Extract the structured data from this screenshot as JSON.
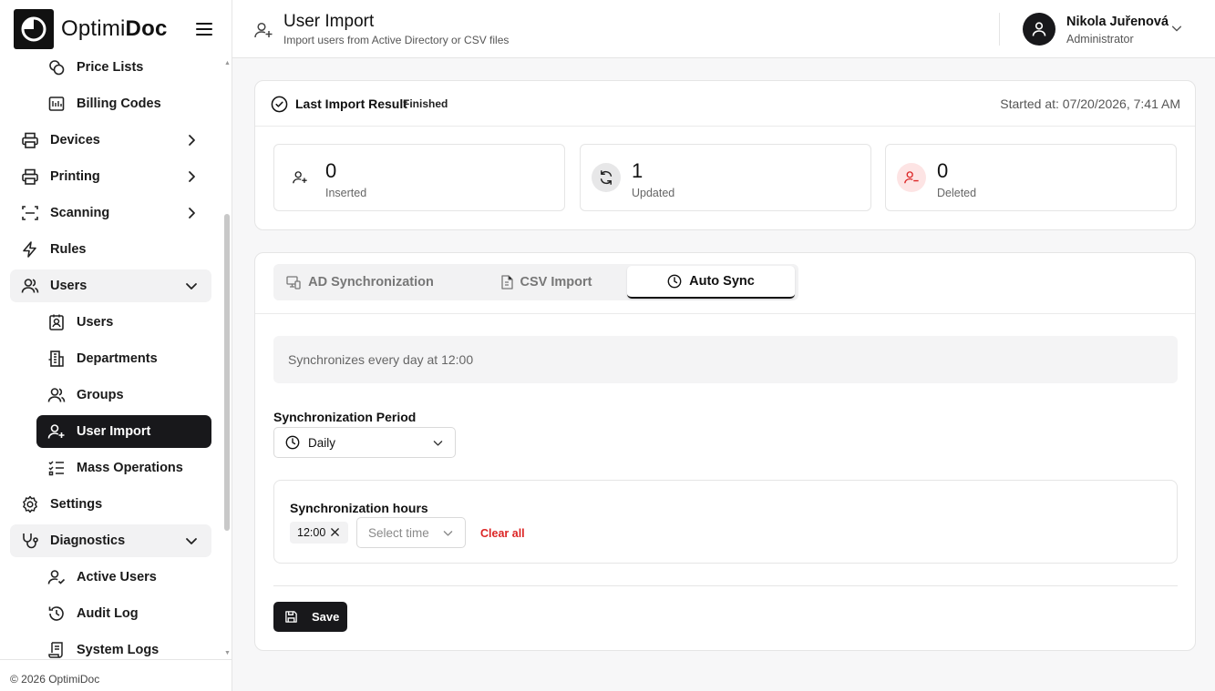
{
  "brand": {
    "name_light": "Optimi",
    "name_bold": "Doc"
  },
  "sidebar": {
    "items": [
      {
        "label": "Price Lists",
        "icon": "coins-icon",
        "level": 2
      },
      {
        "label": "Billing Codes",
        "icon": "billing-icon",
        "level": 2
      },
      {
        "label": "Devices",
        "icon": "printer-icon",
        "level": 1,
        "chevron": "right"
      },
      {
        "label": "Printing",
        "icon": "printer-icon",
        "level": 1,
        "chevron": "right"
      },
      {
        "label": "Scanning",
        "icon": "scan-icon",
        "level": 1,
        "chevron": "right"
      },
      {
        "label": "Rules",
        "icon": "lightning-icon",
        "level": 1
      },
      {
        "label": "Users",
        "icon": "users-icon",
        "level": 1,
        "chevron": "down",
        "open": true
      },
      {
        "label": "Users",
        "icon": "contact-icon",
        "level": 2
      },
      {
        "label": "Departments",
        "icon": "building-icon",
        "level": 2
      },
      {
        "label": "Groups",
        "icon": "users-icon",
        "level": 2
      },
      {
        "label": "User Import",
        "icon": "user-plus-icon",
        "level": 2,
        "active": true
      },
      {
        "label": "Mass Operations",
        "icon": "list-checks-icon",
        "level": 2
      },
      {
        "label": "Settings",
        "icon": "gear-icon",
        "level": 1
      },
      {
        "label": "Diagnostics",
        "icon": "stethoscope-icon",
        "level": 1,
        "chevron": "down",
        "open": true
      },
      {
        "label": "Active Users",
        "icon": "user-check-icon",
        "level": 2
      },
      {
        "label": "Audit Log",
        "icon": "history-icon",
        "level": 2
      },
      {
        "label": "System Logs",
        "icon": "scroll-icon",
        "level": 2
      }
    ],
    "footer": "© 2026 OptimiDoc"
  },
  "header": {
    "title": "User Import",
    "subtitle": "Import users from Active Directory or CSV files",
    "user_name": "Nikola Juřenová",
    "user_role": "Administrator"
  },
  "last_import": {
    "title": "Last Import Result",
    "status": "Finished",
    "started_at": "Started at: 07/20/2026, 7:41 AM",
    "stats": [
      {
        "value": "0",
        "label": "Inserted",
        "icon": "user-plus-icon"
      },
      {
        "value": "1",
        "label": "Updated",
        "icon": "refresh-icon"
      },
      {
        "value": "0",
        "label": "Deleted",
        "icon": "user-minus-icon"
      }
    ]
  },
  "tabs": [
    {
      "label": "AD Synchronization",
      "icon": "ad-sync-icon"
    },
    {
      "label": "CSV Import",
      "icon": "file-icon"
    },
    {
      "label": "Auto Sync",
      "icon": "clock-icon",
      "selected": true
    }
  ],
  "auto_sync": {
    "info": "Synchronizes every day at 12:00",
    "period_label": "Synchronization Period",
    "period_value": "Daily",
    "hours_label": "Synchronization hours",
    "hours": [
      "12:00"
    ],
    "time_placeholder": "Select time",
    "clear_all": "Clear all",
    "save": "Save"
  },
  "colors": {
    "accent": "#18181b",
    "danger": "#dc2626",
    "muted_bg": "#f2f2f3"
  }
}
